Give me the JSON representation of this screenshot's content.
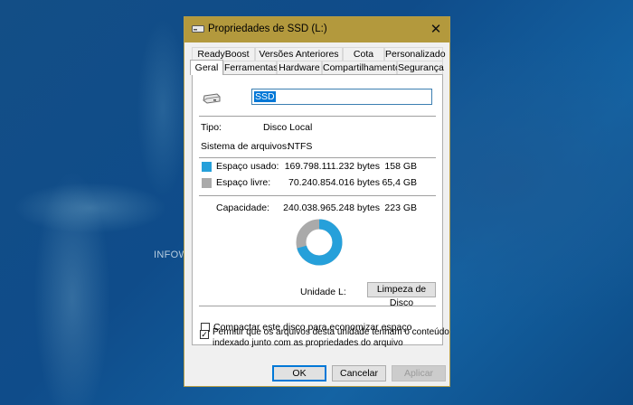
{
  "desktop": {
    "watermark": "INFOWESTER"
  },
  "window": {
    "title": "Propriedades de SSD (L:)",
    "close_symbol": "✕"
  },
  "tabs_row1": [
    "ReadyBoost",
    "Versões Anteriores",
    "Cota",
    "Personalizado"
  ],
  "tabs_row2": [
    "Geral",
    "Ferramentas",
    "Hardware",
    "Compartilhamento",
    "Segurança"
  ],
  "general": {
    "name_value": "SSD",
    "type_label": "Tipo:",
    "type_value": "Disco Local",
    "fs_label": "Sistema de arquivos:",
    "fs_value": "NTFS",
    "used_label": "Espaço usado:",
    "used_bytes": "169.798.111.232 bytes",
    "used_size": "158 GB",
    "free_label": "Espaço livre:",
    "free_bytes": "70.240.854.016 bytes",
    "free_size": "65,4 GB",
    "capacity_label": "Capacidade:",
    "capacity_bytes": "240.038.965.248 bytes",
    "capacity_size": "223 GB",
    "drive_label": "Unidade L:",
    "cleanup_button": "Limpeza de Disco",
    "compress_label": "Compactar este disco para economizar espaço",
    "compress_checked": false,
    "index_label_line1": "Permitir que os arquivos desta unidade tenham o conteúdo",
    "index_label_line2": "indexado junto com as propriedades do arquivo",
    "index_checked": true,
    "check_mark": "✓"
  },
  "usage": {
    "used_fraction": 0.707,
    "free_fraction": 0.293
  },
  "colors": {
    "used": "#26a0da",
    "free": "#aaaaaa",
    "titlebar": "#b3993d"
  },
  "buttons": {
    "ok": "OK",
    "cancel": "Cancelar",
    "apply": "Aplicar"
  }
}
